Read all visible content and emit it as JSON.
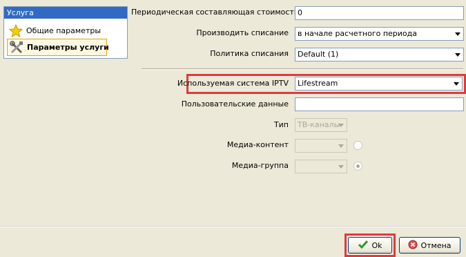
{
  "nav": {
    "header": "Услуга",
    "items": [
      {
        "label": "Общие параметры",
        "icon": "star-icon"
      },
      {
        "label": "Параметры услуги",
        "icon": "tools-icon"
      }
    ]
  },
  "form": {
    "periodic_cost": {
      "label": "Периодическая составляющая стоимости",
      "value": "0"
    },
    "charge_mode": {
      "label": "Производить списание",
      "value": "в начале расчетного периода"
    },
    "charge_policy": {
      "label": "Политика списания",
      "value": "Default (1)"
    },
    "iptv_system": {
      "label": "Используемая система IPTV",
      "value": "Lifestream"
    },
    "user_data": {
      "label": "Пользовательские данные",
      "value": ""
    },
    "type": {
      "label": "Тип",
      "value": "ТВ-каналы"
    },
    "media_content": {
      "label": "Медиа-контент",
      "value": ""
    },
    "media_group": {
      "label": "Медиа-группа",
      "value": ""
    }
  },
  "buttons": {
    "ok": "Ok",
    "cancel": "Отмена"
  },
  "colors": {
    "highlight": "#e0393e",
    "nav_header": "#316ac5",
    "window_bg": "#ece9d8"
  }
}
